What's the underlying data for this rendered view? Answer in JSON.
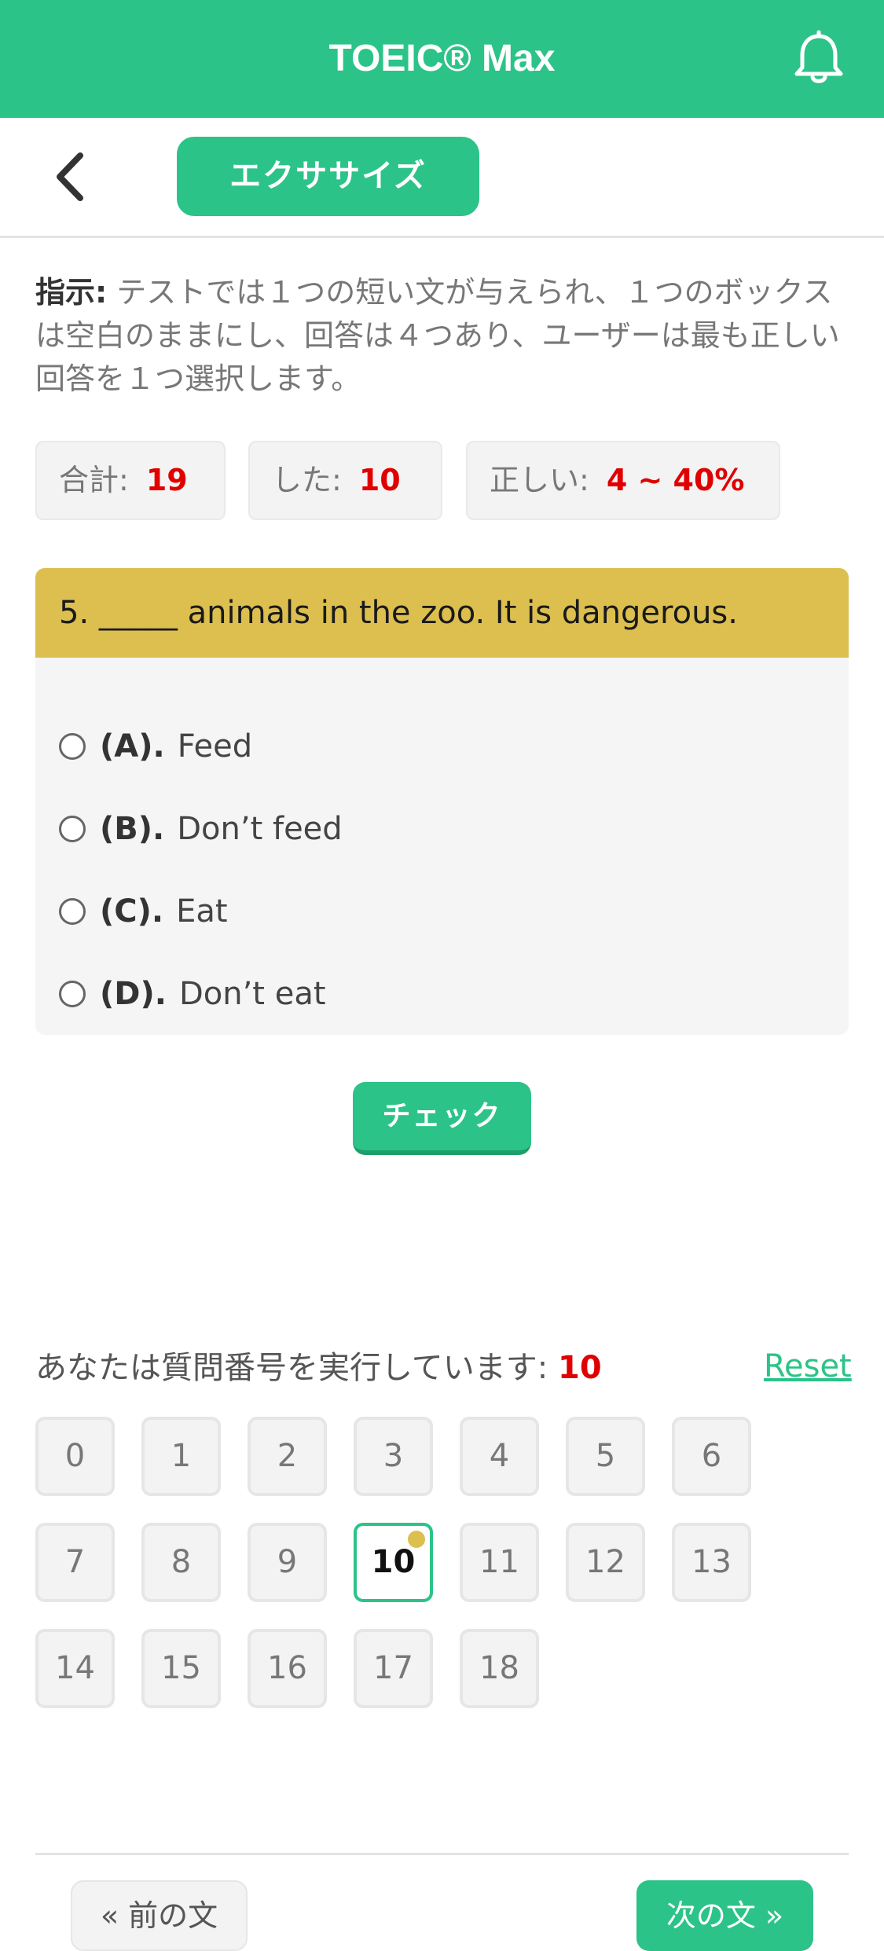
{
  "header": {
    "title": "TOEIC® Max",
    "notification_icon": "bell-icon",
    "background": "#2cc388"
  },
  "subbar": {
    "back_icon": "chevron-left-icon",
    "tab_label": "エクササイズ"
  },
  "instructions": {
    "label": "指示:",
    "text": " テストでは１つの短い文が与えられ、１つのボックスは空白のままにし、回答は４つあり、ユーザーは最も正しい回答を１つ選択します。"
  },
  "stats": {
    "total_label": "合計:",
    "total_value": "19",
    "done_label": "した:",
    "done_value": "10",
    "correct_label": "正しい:",
    "correct_value": "4 ~ 40%"
  },
  "question": {
    "text": "5. _____ animals in the zoo. It is dangerous.",
    "options": [
      {
        "letter": "(A).",
        "text": "Feed"
      },
      {
        "letter": "(B).",
        "text": "Don’t feed"
      },
      {
        "letter": "(C).",
        "text": "Eat"
      },
      {
        "letter": "(D).",
        "text": "Don’t eat"
      }
    ]
  },
  "check_button": "チェック",
  "progress": {
    "label": "あなたは質問番号を実行しています: ",
    "current": "10",
    "reset_label": "Reset",
    "numbers": [
      "0",
      "1",
      "2",
      "3",
      "4",
      "5",
      "6",
      "7",
      "8",
      "9",
      "10",
      "11",
      "12",
      "13",
      "14",
      "15",
      "16",
      "17",
      "18"
    ],
    "active_index": 10
  },
  "nav": {
    "prev_label": "« 前の文",
    "next_label": "次の文 »"
  },
  "colors": {
    "accent": "#2cc388",
    "question_header": "#dcbf4f",
    "highlight_value": "#e00000"
  }
}
